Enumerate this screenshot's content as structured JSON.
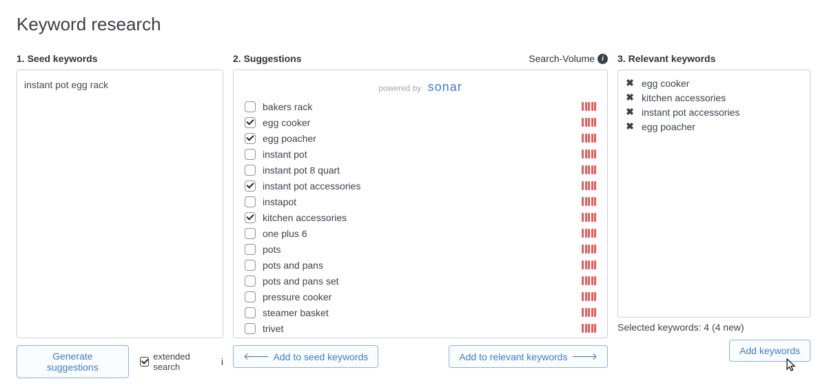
{
  "page_title": "Keyword research",
  "seed": {
    "header": "1. Seed keywords",
    "value": "instant pot egg rack",
    "generate_button": "Generate suggestions",
    "extended_search_label": "extended search",
    "extended_search_checked": true
  },
  "suggestions": {
    "header": "2. Suggestions",
    "search_volume_label": "Search-Volume",
    "powered_by_prefix": "powered by",
    "powered_by_brand": "sonar",
    "add_to_seed_button": "Add to seed keywords",
    "add_to_relevant_button": "Add to relevant keywords",
    "items": [
      {
        "label": "bakers rack",
        "checked": false,
        "volume": 5
      },
      {
        "label": "egg cooker",
        "checked": true,
        "volume": 5
      },
      {
        "label": "egg poacher",
        "checked": true,
        "volume": 5
      },
      {
        "label": "instant pot",
        "checked": false,
        "volume": 5
      },
      {
        "label": "instant pot 8 quart",
        "checked": false,
        "volume": 5
      },
      {
        "label": "instant pot accessories",
        "checked": true,
        "volume": 5
      },
      {
        "label": "instapot",
        "checked": false,
        "volume": 5
      },
      {
        "label": "kitchen accessories",
        "checked": true,
        "volume": 5
      },
      {
        "label": "one plus 6",
        "checked": false,
        "volume": 5
      },
      {
        "label": "pots",
        "checked": false,
        "volume": 5
      },
      {
        "label": "pots and pans",
        "checked": false,
        "volume": 5
      },
      {
        "label": "pots and pans set",
        "checked": false,
        "volume": 5
      },
      {
        "label": "pressure cooker",
        "checked": false,
        "volume": 5
      },
      {
        "label": "steamer basket",
        "checked": false,
        "volume": 5
      },
      {
        "label": "trivet",
        "checked": false,
        "volume": 5
      }
    ]
  },
  "relevant": {
    "header": "3. Relevant keywords",
    "items": [
      "egg cooker",
      "kitchen accessories",
      "instant pot accessories",
      "egg poacher"
    ],
    "selected_summary": "Selected keywords: 4 (4 new)",
    "add_button": "Add keywords"
  }
}
